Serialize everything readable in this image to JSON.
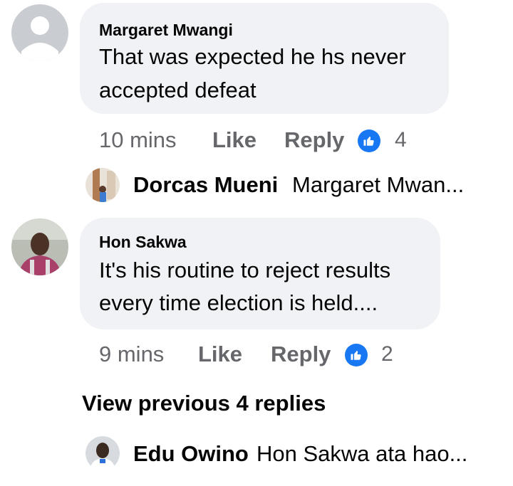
{
  "comments": [
    {
      "author": "Margaret Mwangi",
      "text_lines": [
        "That was expected he hs never",
        "accepted defeat"
      ],
      "time": "10 mins",
      "like_label": "Like",
      "reply_label": "Reply",
      "reaction_icon": "thumbs-up-icon",
      "reaction_count": "4",
      "avatar": "default-person-avatar"
    },
    {
      "author": "Hon Sakwa",
      "text_lines": [
        "It's his routine to reject results",
        "every time election is held...."
      ],
      "time": "9 mins",
      "like_label": "Like",
      "reply_label": "Reply",
      "reaction_icon": "thumbs-up-icon",
      "reaction_count": "2",
      "avatar": "profile-photo"
    }
  ],
  "replies": [
    {
      "author": "Dorcas Mueni",
      "snippet": "Margaret Mwan..."
    },
    {
      "author": "Edu Owino",
      "snippet": "Hon Sakwa ata hao..."
    }
  ],
  "view_previous_label": "View previous 4 replies",
  "colors": {
    "bubble": "#f0f2f5",
    "secondary_text": "#65676b",
    "primary_text": "#050505",
    "reaction_blue": "#1877f2"
  }
}
